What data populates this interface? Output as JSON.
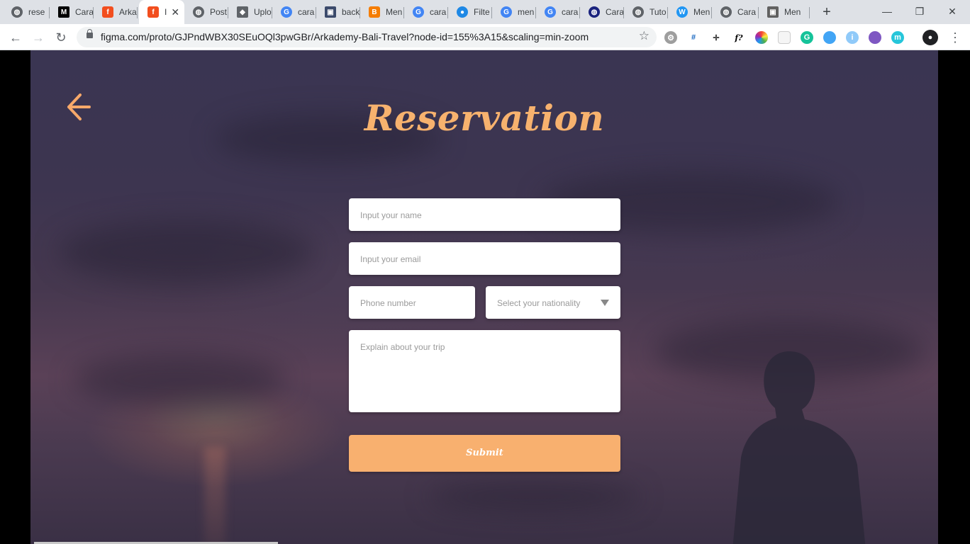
{
  "browser": {
    "tabs": [
      {
        "label": "rese",
        "icon": "globe-icon",
        "color": "#5f6368"
      },
      {
        "label": "Cara",
        "icon": "medium-icon",
        "color": "#000000"
      },
      {
        "label": "Arka",
        "icon": "figma-icon",
        "color": "#f24e1e"
      },
      {
        "label": "I",
        "icon": "figma-icon",
        "color": "#f24e1e",
        "active": true
      },
      {
        "label": "Post",
        "icon": "globe-icon",
        "color": "#5f6368"
      },
      {
        "label": "Uplo",
        "icon": "layers-icon",
        "color": "#5f6368"
      },
      {
        "label": "cara",
        "icon": "google-icon",
        "color": "#4285f4"
      },
      {
        "label": "back",
        "icon": "app-icon",
        "color": "#3b4a6b"
      },
      {
        "label": "Men",
        "icon": "blogger-icon",
        "color": "#f57d00"
      },
      {
        "label": "cara",
        "icon": "google-icon",
        "color": "#4285f4"
      },
      {
        "label": "Filte",
        "icon": "filter-icon",
        "color": "#1e88e5"
      },
      {
        "label": "men",
        "icon": "google-icon",
        "color": "#4285f4"
      },
      {
        "label": "cara",
        "icon": "google-icon",
        "color": "#4285f4"
      },
      {
        "label": "Cara",
        "icon": "globe-dark-icon",
        "color": "#1a237e"
      },
      {
        "label": "Tuto",
        "icon": "globe-icon",
        "color": "#5f6368"
      },
      {
        "label": "Men",
        "icon": "wp-icon",
        "color": "#2196f3"
      },
      {
        "label": "Cara",
        "icon": "globe-icon",
        "color": "#5f6368"
      },
      {
        "label": "Men",
        "icon": "app-icon",
        "color": "#616161"
      }
    ],
    "url": "figma.com/proto/GJPndWBX30SEuOQl3pwGBr/Arkademy-Bali-Travel?node-id=155%3A15&scaling=min-zoom",
    "window_controls": [
      "—",
      "❐",
      "✕"
    ]
  },
  "page": {
    "title": "Reservation",
    "form": {
      "name_placeholder": "Input your name",
      "email_placeholder": "Input your email",
      "phone_placeholder": "Phone number",
      "nationality_placeholder": "Select your nationality",
      "trip_placeholder": "Explain about your trip",
      "submit_label": "Submit"
    },
    "accent_color": "#f8b06f"
  }
}
